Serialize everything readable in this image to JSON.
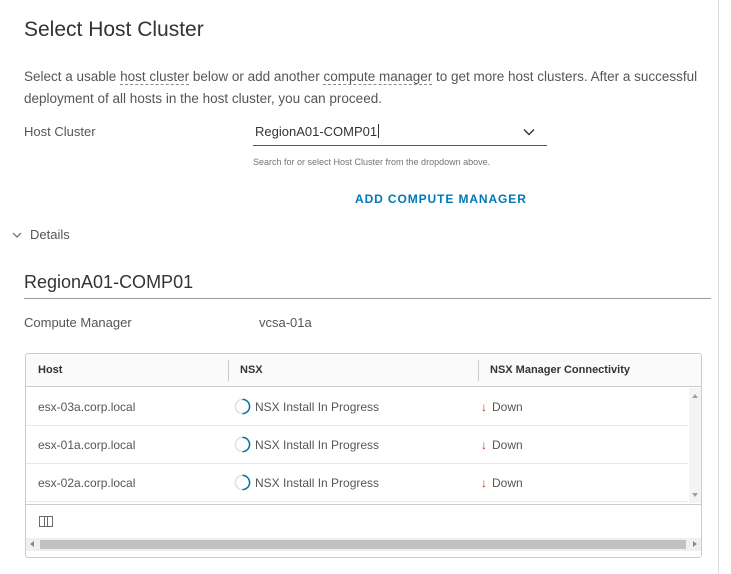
{
  "page": {
    "title": "Select Host Cluster",
    "intro": {
      "part1": "Select a usable ",
      "link1": "host cluster",
      "part2": " below or add another ",
      "link2": "compute manager",
      "part3": " to get more host clusters. After a successful deployment of all hosts in the host cluster, you can proceed."
    }
  },
  "host_cluster": {
    "label": "Host Cluster",
    "value": "RegionA01-COMP01",
    "helper": "Search for or select Host Cluster from the dropdown above.",
    "add_button": "ADD COMPUTE MANAGER"
  },
  "details": {
    "toggle_label": "Details",
    "title": "RegionA01-COMP01",
    "compute_manager_label": "Compute Manager",
    "compute_manager_value": "vcsa-01a"
  },
  "grid": {
    "columns": [
      "Host",
      "NSX",
      "NSX Manager Connectivity"
    ],
    "rows": [
      {
        "host": "esx-03a.corp.local",
        "nsx": "NSX Install In Progress",
        "connectivity": "Down"
      },
      {
        "host": "esx-01a.corp.local",
        "nsx": "NSX Install In Progress",
        "connectivity": "Down"
      },
      {
        "host": "esx-02a.corp.local",
        "nsx": "NSX Install In Progress",
        "connectivity": "Down"
      }
    ]
  },
  "colors": {
    "accent": "#0079b8",
    "down": "#e02200",
    "spinner": "#0072a3"
  }
}
